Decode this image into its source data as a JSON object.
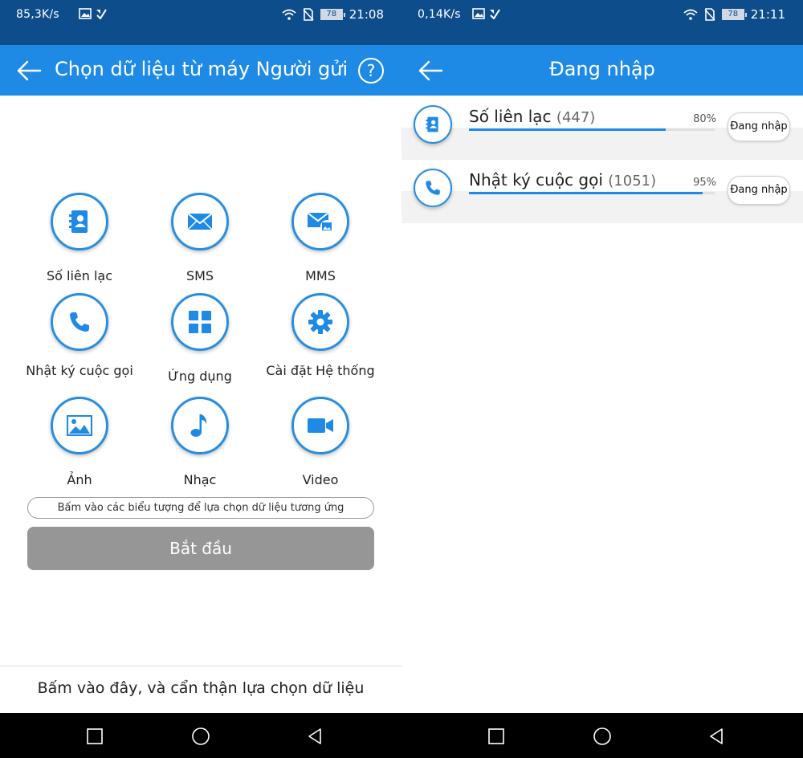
{
  "left": {
    "status": {
      "speed": "85,3K/s",
      "battery": "78",
      "time": "21:08"
    },
    "title": "Chọn dữ liệu từ máy Người gửi",
    "help": "?",
    "items": [
      {
        "label": "Số liên lạc",
        "icon": "contacts-icon"
      },
      {
        "label": "SMS",
        "icon": "sms-icon"
      },
      {
        "label": "MMS",
        "icon": "mms-icon"
      },
      {
        "label": "Nhật ký cuộc gọi",
        "icon": "call-log-icon"
      },
      {
        "label": "Ứng dụng",
        "icon": "apps-icon"
      },
      {
        "label": "Cài đặt Hệ thống",
        "icon": "settings-icon"
      },
      {
        "label": "Ảnh",
        "icon": "photo-icon"
      },
      {
        "label": "Nhạc",
        "icon": "music-icon"
      },
      {
        "label": "Video",
        "icon": "video-icon"
      }
    ],
    "hint": "Bấm vào các biểu tượng để lựa chọn dữ liệu tương ứng",
    "start_label": "Bắt đầu",
    "bottom_tip": "Bấm vào đây, và cẩn thận lựa chọn dữ liệu"
  },
  "right": {
    "status": {
      "speed": "0,14K/s",
      "battery": "78",
      "time": "21:11"
    },
    "title": "Đang nhập",
    "rows": [
      {
        "name": "Số liên lạc",
        "count": "(447)",
        "percent_label": "80%",
        "progress": 0.8,
        "button": "Đang nhập",
        "icon": "contacts-icon"
      },
      {
        "name": "Nhật ký cuộc gọi",
        "count": "(1051)",
        "percent_label": "95%",
        "progress": 0.95,
        "button": "Đang nhập",
        "icon": "call-log-icon"
      }
    ]
  },
  "colors": {
    "status_bar": "#0d4d8c",
    "app_bar": "#1f8ae6",
    "accent": "#2a8ee0",
    "start_button": "#969696"
  }
}
